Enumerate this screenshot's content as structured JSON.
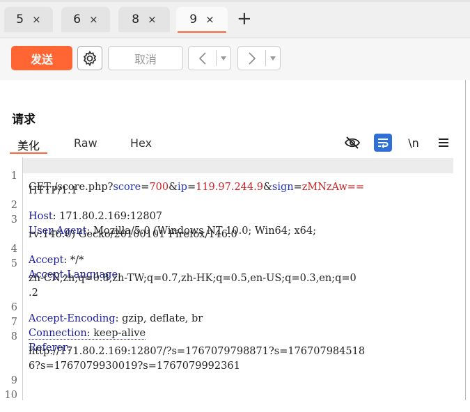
{
  "tabs": [
    {
      "label": "5",
      "close": "×"
    },
    {
      "label": "6",
      "close": "×"
    },
    {
      "label": "8",
      "close": "×"
    },
    {
      "label": "9",
      "close": "×"
    }
  ],
  "add_tab": "+",
  "toolbar": {
    "send_label": "发送",
    "cancel_label": "取消",
    "back_arrow": "<",
    "forward_arrow": ">",
    "dropdown_arrow": "▾"
  },
  "panel": {
    "title": "请求",
    "subtabs": [
      "美化",
      "Raw",
      "Hex"
    ],
    "newline_toggle": "\\n"
  },
  "colors": {
    "accent": "#ff6633",
    "header_key": "#1a1aa0",
    "param_value": "#cc2222",
    "toggle_on": "#2f6fd6"
  },
  "request": {
    "line_numbers": [
      "1",
      "",
      "2",
      "3",
      "",
      "4",
      "5",
      "",
      "",
      "6",
      "7",
      "8",
      "",
      "",
      "9",
      "10"
    ],
    "method": "GET",
    "path": " /score.php?",
    "p1_key": "score",
    "p1_val": "700",
    "p2_key": "ip",
    "p2_val": "119.97.244.9",
    "p3_key": "sign",
    "p3_val": "zMNzAw==",
    "amp": "&",
    "eq": "=",
    "version": "HTTP/1.1",
    "host_key": "Host",
    "host_val": " 171.80.2.169:12807",
    "ua_key": "User-Agent",
    "ua_val1": " Mozilla/5.0 (Windows NT 10.0; Win64; x64;",
    "ua_val2": "rv:146.0) Gecko/20100101 Firefox/146.0",
    "accept_key": "Accept",
    "accept_val": " */*",
    "lang_key": "Accept-Language",
    "lang_val1": "zh-CN,zh;q=0.8,zh-TW;q=0.7,zh-HK;q=0.5,en-US;q=0.3,en;q=0",
    "lang_val2": ".2",
    "enc_key": "Accept-Encoding",
    "enc_val": " gzip, deflate, br",
    "conn_key": "Connection",
    "conn_val": " keep-alive",
    "ref_key": "Referer",
    "ref_val1": "http://171.80.2.169:12807/?s=1767079798871?s=176707984518",
    "ref_val2": "6?s=1767079930019?s=1767079992361",
    "colon": ":"
  }
}
